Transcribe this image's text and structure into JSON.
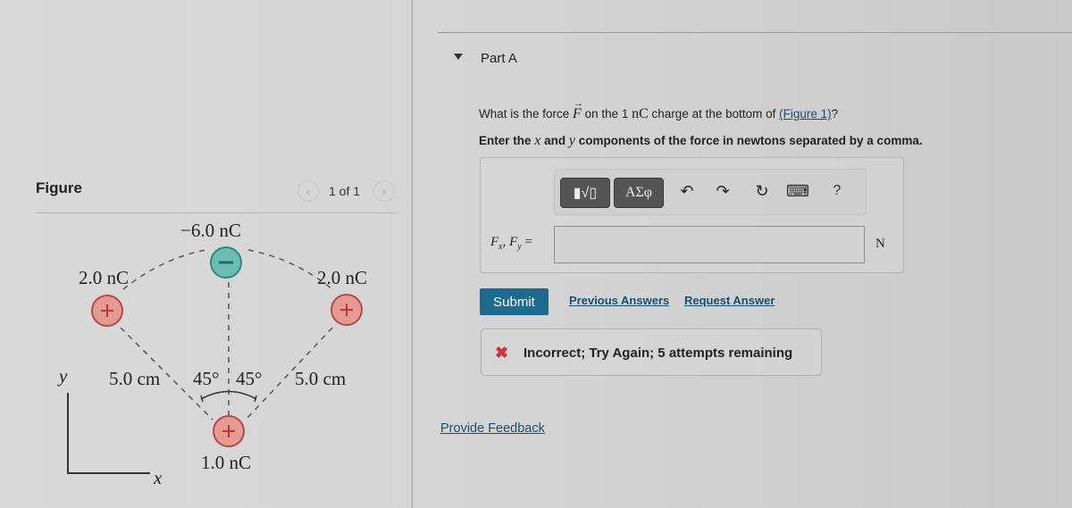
{
  "figure_panel": {
    "title": "Figure",
    "pager": "1 of 1",
    "prev_icon": "chevron-left-icon",
    "next_icon": "chevron-right-icon",
    "diagram": {
      "top_charge": {
        "label": "−6.0 nC",
        "sign": "−",
        "color": "#6cbcb4"
      },
      "left_charge": {
        "label": "2.0 nC",
        "sign": "+",
        "color": "#e59a94"
      },
      "right_charge": {
        "label": "2.0 nC",
        "sign": "+",
        "color": "#e59a94"
      },
      "bottom_charge": {
        "label": "1.0 nC",
        "sign": "+",
        "color": "#e59a94"
      },
      "left_distance": "5.0 cm",
      "right_distance": "5.0 cm",
      "left_angle": "45°",
      "right_angle": "45°",
      "axis_x": "x",
      "axis_y": "y"
    }
  },
  "part": {
    "title": "Part A",
    "question_pre": "What is the force ",
    "question_symbol": "F",
    "question_mid": " on the 1 ",
    "question_unit": "nC",
    "question_post": " charge at the bottom of ",
    "figure_link": "(Figure 1)",
    "question_end": "?",
    "instruction_pre": "Enter the ",
    "instruction_x": "x",
    "instruction_and": " and ",
    "instruction_y": "y",
    "instruction_post": " components of the force in newtons separated by a comma."
  },
  "toolbar": {
    "templates_label": "▮√▯",
    "symbols_label": "ΑΣφ",
    "undo": "↶",
    "redo": "↷",
    "reset": "↻",
    "keyboard": "⌨",
    "help": "?"
  },
  "answer": {
    "label_F1": "F",
    "label_sub1": "x",
    "label_sep": ", ",
    "label_F2": "F",
    "label_sub2": "y",
    "label_eq": " =",
    "value": "",
    "unit": "N"
  },
  "actions": {
    "submit": "Submit",
    "previous_answers": "Previous Answers",
    "request_answer": "Request Answer"
  },
  "feedback": {
    "icon": "✖",
    "text": "Incorrect; Try Again; 5 attempts remaining",
    "icon_color": "#d0333a"
  },
  "provide_feedback": "Provide Feedback",
  "colors": {
    "submit_bg": "#1c6b8f",
    "link": "#1a4e72"
  }
}
